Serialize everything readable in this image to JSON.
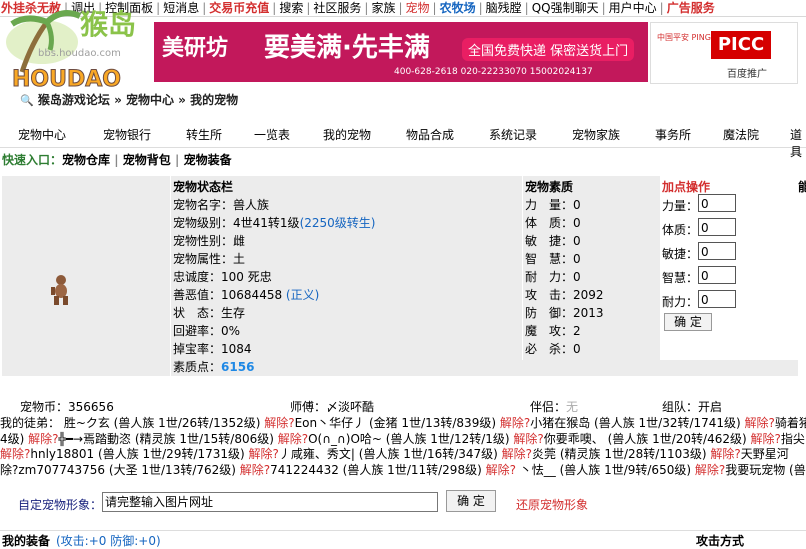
{
  "topbar": {
    "items": [
      {
        "label": "外挂杀无赦",
        "color": "#d32f2f",
        "bold": true
      },
      {
        "label": "调出",
        "color": "#000000"
      },
      {
        "label": "控制面板",
        "color": "#000000"
      },
      {
        "label": "短消息",
        "color": "#000000"
      },
      {
        "label": "交易币充值",
        "color": "#d32f2f",
        "bold": true
      },
      {
        "label": "搜索",
        "color": "#000000"
      },
      {
        "label": "社区服务",
        "color": "#000000"
      },
      {
        "label": "家族",
        "color": "#000000"
      },
      {
        "label": "宠物",
        "color": "#d32f2f"
      },
      {
        "label": "农牧场",
        "color": "#1565c0",
        "bold": true
      },
      {
        "label": "脑残膛",
        "color": "#000000"
      },
      {
        "label": "QQ强制聊天",
        "color": "#000000"
      },
      {
        "label": "用户中心",
        "color": "#000000"
      },
      {
        "label": "广告服务",
        "color": "#d32f2f",
        "bold": true
      }
    ]
  },
  "logo": {
    "text": "猴岛",
    "subtext": "bbs.houdao.com",
    "brand": "HOUDAO"
  },
  "banner": {
    "brand": "美研坊",
    "slogan": "要美满·先丰满",
    "service": "全国免费快递 保密送货上门",
    "phones": "400-628-2618  020-22233070  15002024137"
  },
  "ad_side": {
    "top": "中国平安 PINGAN",
    "brand": "PICC",
    "footer": "百度推广"
  },
  "breadcrumb": {
    "text": "猴岛游戏论坛 » 宠物中心 » 我的宠物"
  },
  "nav": [
    "宠物中心",
    "宠物银行",
    "转生所",
    "一览表",
    "我的宠物",
    "物品合成",
    "系统记录",
    "宠物家族",
    "事务所",
    "魔法院",
    "道具"
  ],
  "quick": {
    "label": "快速入口：",
    "links": [
      "宠物仓库",
      "宠物背包",
      "宠物装备"
    ]
  },
  "status": {
    "title": "宠物状态栏",
    "name_label": "宠物名字：",
    "name_value": "兽人族",
    "level_label": "宠物级别：",
    "level_value": "4世41转1级",
    "level_total": "(2250级转生)",
    "gender_label": "宠物性别：",
    "gender_value": "雌",
    "attr_label": "宠物属性：",
    "attr_value": "土",
    "loyalty_label": "忠诚度：",
    "loyalty_value": "100 死忠",
    "karma_label": "善恶值：",
    "karma_value": "10684458",
    "karma_tag": "(正义)",
    "state_label": "状　态：",
    "state_value": "生存",
    "dodge_label": "回避率：",
    "dodge_value": "0%",
    "drop_label": "掉宝率：",
    "drop_value": "1084",
    "points_label": "素质点：",
    "points_value": "6156"
  },
  "quality": {
    "title": "宠物素质",
    "rows": [
      {
        "label": "力　量：",
        "value": "0"
      },
      {
        "label": "体　质：",
        "value": "0"
      },
      {
        "label": "敏　捷：",
        "value": "0"
      },
      {
        "label": "智　慧：",
        "value": "0"
      },
      {
        "label": "耐　力：",
        "value": "0"
      },
      {
        "label": "攻　击：",
        "value": "2092"
      },
      {
        "label": "防　御：",
        "value": "2013"
      },
      {
        "label": "魔　攻：",
        "value": "2"
      },
      {
        "label": "必　杀：",
        "value": "0"
      }
    ]
  },
  "addpts": {
    "title": "加点操作",
    "fields": [
      {
        "label": "力量：",
        "value": "0"
      },
      {
        "label": "体质：",
        "value": "0"
      },
      {
        "label": "敏捷：",
        "value": "0"
      },
      {
        "label": "智慧：",
        "value": "0"
      },
      {
        "label": "耐力：",
        "value": "0"
      }
    ],
    "confirm": "确 定"
  },
  "side_col": {
    "label": "能"
  },
  "summary": {
    "coins_label": "宠物币：",
    "coins_value": "356656",
    "master_label": "师傅：",
    "master_value": "〆淡吥酷",
    "partner_label": "伴侣：",
    "partner_value": "无",
    "team_label": "组队：",
    "team_value": "开启"
  },
  "disciples": {
    "label": "我的徒弟：",
    "lines": [
      "我的徒弟： 胜~ク玄 (兽人族 1世/26转/1352级) 解除?Eon丶华仔丿 (金猪 1世/13转/839级) 解除?小猪在猴岛 (兽人族 1世/32转/1741级) 解除?骑着猪",
      "4级) 解除?╬━→焉踏動恣 (精灵族 1世/15转/806级) 解除?O(∩_∩)O哈~ (兽人族 1世/12转/1级) 解除?你要乖噢、 (兽人族 1世/20转/462级) 解除?指尖",
      "解除?hnly18801 (兽人族 1世/29转/1731级) 解除?丿咸雍、秀文| (兽人族 1世/16转/347级) 解除?炎莞 (精灵族 1世/28转/1103级) 解除?天野星河",
      "除?zm707743756 (大圣 1世/13转/762级) 解除?741224432 (兽人族 1世/11转/298级) 解除? 丶怯__ (兽人族 1世/9转/650级) 解除?我要玩宠物 (兽人"
    ]
  },
  "custom_image": {
    "label": "自定宠物形象：",
    "placeholder": "请完整输入图片网址",
    "confirm": "确 定",
    "restore": "还原宠物形象"
  },
  "equipment": {
    "label": "我的装备",
    "stats": "(攻击:+0 防御:+0)",
    "attack_mode": "攻击方式"
  }
}
